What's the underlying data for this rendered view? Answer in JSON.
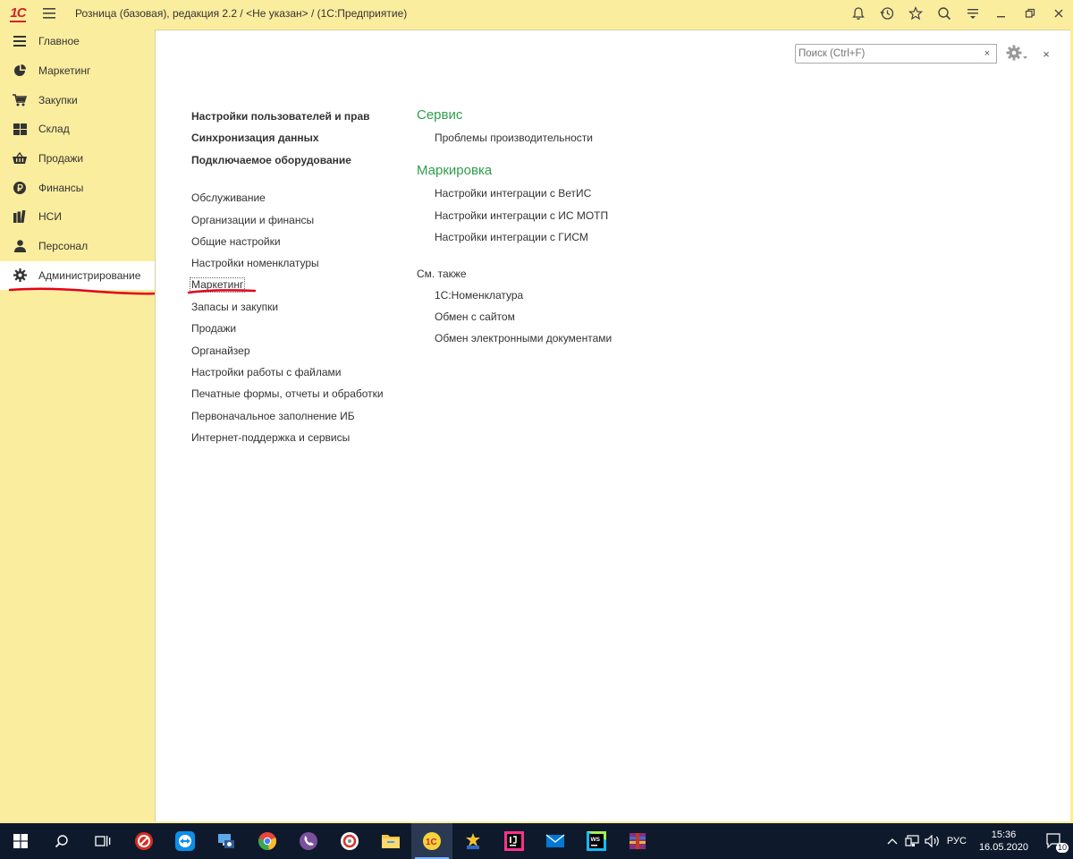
{
  "window": {
    "logo_text": "1С",
    "title": "Розница (базовая), редакция 2.2 / <Не указан> /  (1С:Предприятие)"
  },
  "sidebar": {
    "items": [
      {
        "label": "Главное",
        "icon": "menu-lines-icon"
      },
      {
        "label": "Маркетинг",
        "icon": "pie-chart-icon"
      },
      {
        "label": "Закупки",
        "icon": "cart-icon"
      },
      {
        "label": "Склад",
        "icon": "warehouse-grid-icon"
      },
      {
        "label": "Продажи",
        "icon": "basket-icon"
      },
      {
        "label": "Финансы",
        "icon": "ruble-coin-icon"
      },
      {
        "label": "НСИ",
        "icon": "books-icon"
      },
      {
        "label": "Персонал",
        "icon": "person-icon"
      },
      {
        "label": "Администрирование",
        "icon": "gear-icon",
        "active": true
      }
    ]
  },
  "search": {
    "placeholder": "Поиск (Ctrl+F)",
    "clear_label": "×"
  },
  "close_label": "×",
  "left_column": {
    "bold_links": [
      "Настройки пользователей и прав",
      "Синхронизация данных",
      "Подключаемое оборудование"
    ],
    "links": [
      "Обслуживание",
      "Организации и финансы",
      "Общие настройки",
      "Настройки номенклатуры",
      "Маркетинг",
      "Запасы и закупки",
      "Продажи",
      "Органайзер",
      "Настройки работы с файлами",
      "Печатные формы, отчеты и обработки",
      "Первоначальное заполнение ИБ",
      "Интернет-поддержка и сервисы"
    ]
  },
  "right_column": {
    "groups": [
      {
        "title": "Сервис",
        "links": [
          "Проблемы производительности"
        ]
      },
      {
        "title": "Маркировка",
        "links": [
          "Настройки интеграции с ВетИС",
          "Настройки интеграции с ИС МОТП",
          "Настройки интеграции с ГИСМ"
        ]
      }
    ],
    "see_also_title": "См. также",
    "see_also_links": [
      "1С:Номенклатура",
      "Обмен с сайтом",
      "Обмен электронными документами"
    ]
  },
  "taskbar": {
    "language": "РУС",
    "time": "15:36",
    "date": "16.05.2020",
    "notifications_count": "10"
  },
  "colors": {
    "sidebar_bg": "#fbed9e",
    "group_title": "#2e9f4b",
    "annotation_red": "#e3001b",
    "taskbar_bg": "#0e1a2c"
  }
}
